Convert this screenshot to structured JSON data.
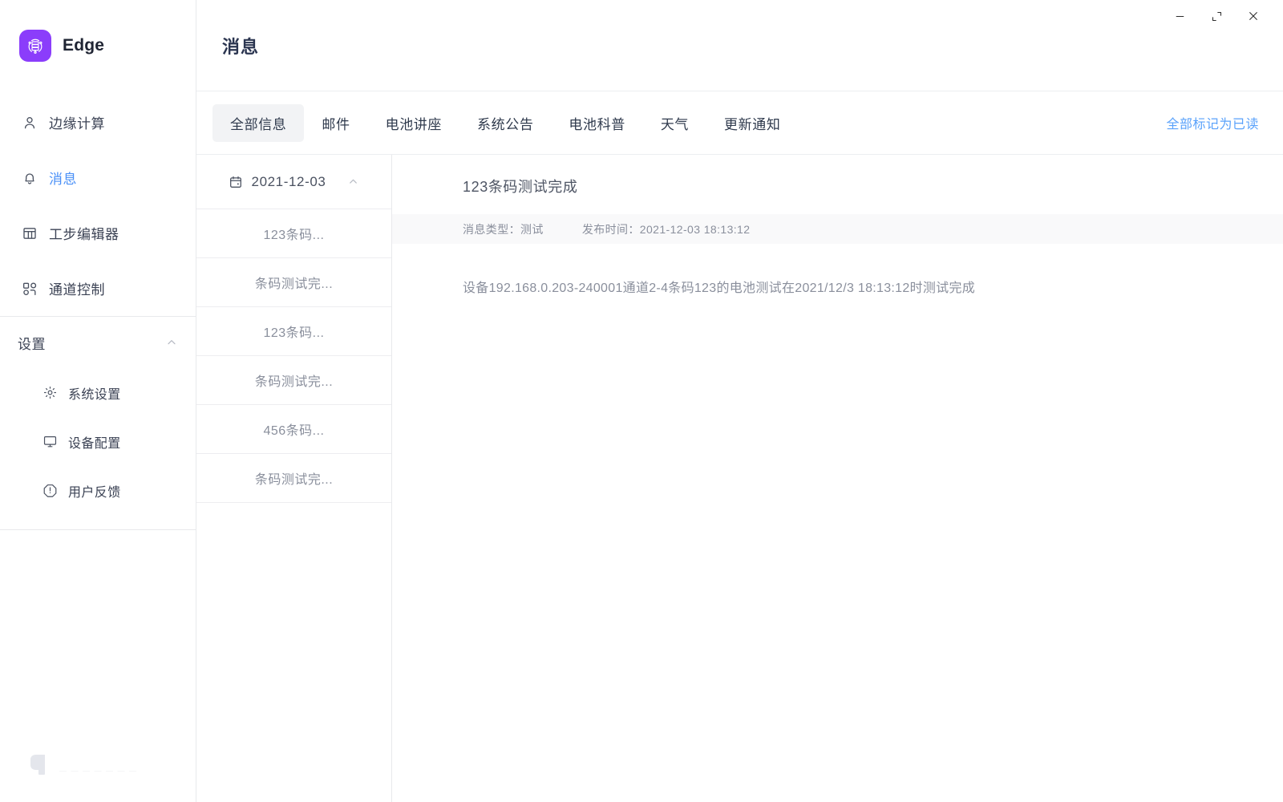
{
  "app": {
    "brand_name": "Edge",
    "logo_icon": "server-network-icon",
    "brand_color": "#8b3dfb"
  },
  "titlebar": {
    "minimize_icon": "minimize-icon",
    "maximize_icon": "maximize-icon",
    "close_icon": "close-icon"
  },
  "sidebar": {
    "items": [
      {
        "label": "边缘计算",
        "icon": "user-icon",
        "active": false
      },
      {
        "label": "消息",
        "icon": "bell-icon",
        "active": true
      },
      {
        "label": "工步编辑器",
        "icon": "grid-table-icon",
        "active": false
      },
      {
        "label": "通道控制",
        "icon": "nodes-icon",
        "active": false
      }
    ],
    "settings": {
      "label": "设置",
      "chevron_icon": "chevron-up-icon",
      "expanded": true,
      "items": [
        {
          "label": "系统设置",
          "icon": "gear-icon"
        },
        {
          "label": "设备配置",
          "icon": "monitor-icon"
        },
        {
          "label": "用户反馈",
          "icon": "alert-octagon-icon"
        }
      ]
    },
    "watermark": {
      "icon": "company-logo-watermark-icon",
      "text": "— — — — — — —"
    }
  },
  "page": {
    "title": "消息"
  },
  "tabs": {
    "items": [
      {
        "label": "全部信息",
        "active": true
      },
      {
        "label": "邮件",
        "active": false
      },
      {
        "label": "电池讲座",
        "active": false
      },
      {
        "label": "系统公告",
        "active": false
      },
      {
        "label": "电池科普",
        "active": false
      },
      {
        "label": "天气",
        "active": false
      },
      {
        "label": "更新通知",
        "active": false
      }
    ],
    "mark_all_read": "全部标记为已读"
  },
  "message_list": {
    "date_group": {
      "calendar_icon": "calendar-icon",
      "date": "2021-12-03",
      "chevron_icon": "chevron-up-icon"
    },
    "items": [
      {
        "label": "123条码..."
      },
      {
        "label": "条码测试完..."
      },
      {
        "label": "123条码..."
      },
      {
        "label": "条码测试完..."
      },
      {
        "label": "456条码..."
      },
      {
        "label": "条码测试完..."
      }
    ]
  },
  "detail": {
    "title": "123条码测试完成",
    "type_label": "消息类型：测试",
    "time_label": "发布时间：2021-12-03 18:13:12",
    "body": "设备192.168.0.203-240001通道2-4条码123的电池测试在2021/12/3 18:13:12时测试完成"
  }
}
